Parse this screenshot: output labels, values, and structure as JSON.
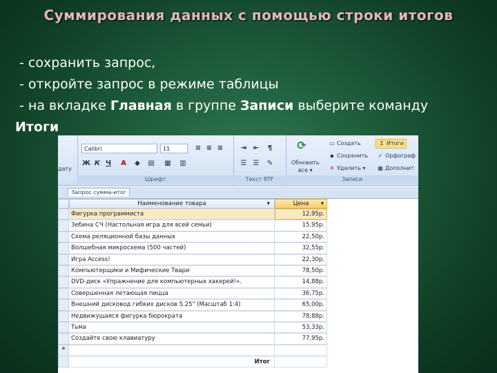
{
  "title": "Суммирования данных с помощью строки итогов",
  "bullets": {
    "line1": "- сохранить запрос,",
    "line2": "- откройте запрос в режиме таблицы",
    "line3_prefix": "- на вкладке ",
    "line3_tab": "Главная",
    "line3_mid": "  в группе ",
    "line3_group": "Записи",
    "line3_suffix": " выберите команду",
    "line4": "Итоги"
  },
  "ribbon": {
    "left_edge": "дату",
    "font_combo": "Calibri",
    "size_combo": "11",
    "font_group": "Шрифт",
    "rtf_group": "Текст RTF",
    "refresh_label": "Обновить",
    "refresh_sub": "все ▾",
    "create": "Создать",
    "save": "Сохранить",
    "delete": "Удалить ▾",
    "itogi": "Итоги",
    "spelling": "Орфограф",
    "more": "Дополнит",
    "records_group": "Записи"
  },
  "object_tab": "Запрос сумма-итог",
  "columns": {
    "name": "Наименование товара",
    "price": "Цена"
  },
  "rows": [
    {
      "name": "Фигурка программиста",
      "price": "12,95р."
    },
    {
      "name": "Зебина СЧ (Настольная игра для всей семьи)",
      "price": "15,95р."
    },
    {
      "name": "Схема реляционной базы данных",
      "price": "22,50р."
    },
    {
      "name": "Волшебная микросхема (500 частей)",
      "price": "32,55р."
    },
    {
      "name": "Игра Access!",
      "price": "22,30р."
    },
    {
      "name": "Компьютерщики и Мифические Твари",
      "price": "78,50р."
    },
    {
      "name": "DVD-диск «Упражнение для компьютерных хакерей!».",
      "price": "14,88р."
    },
    {
      "name": "Совершенная летающая пицца",
      "price": "36,75р."
    },
    {
      "name": "Внешний дисковод гибких дисков 5.25\" (Масштаб 1:4)",
      "price": "65,00р."
    },
    {
      "name": "Недвижущаяся фигурка бюрократа",
      "price": "78,88р."
    },
    {
      "name": "Тьма",
      "price": "53,33р."
    },
    {
      "name": "Создайте свою клавиатуру",
      "price": "77,95р."
    }
  ],
  "new_row_marker": "*",
  "total_label": "Итог"
}
